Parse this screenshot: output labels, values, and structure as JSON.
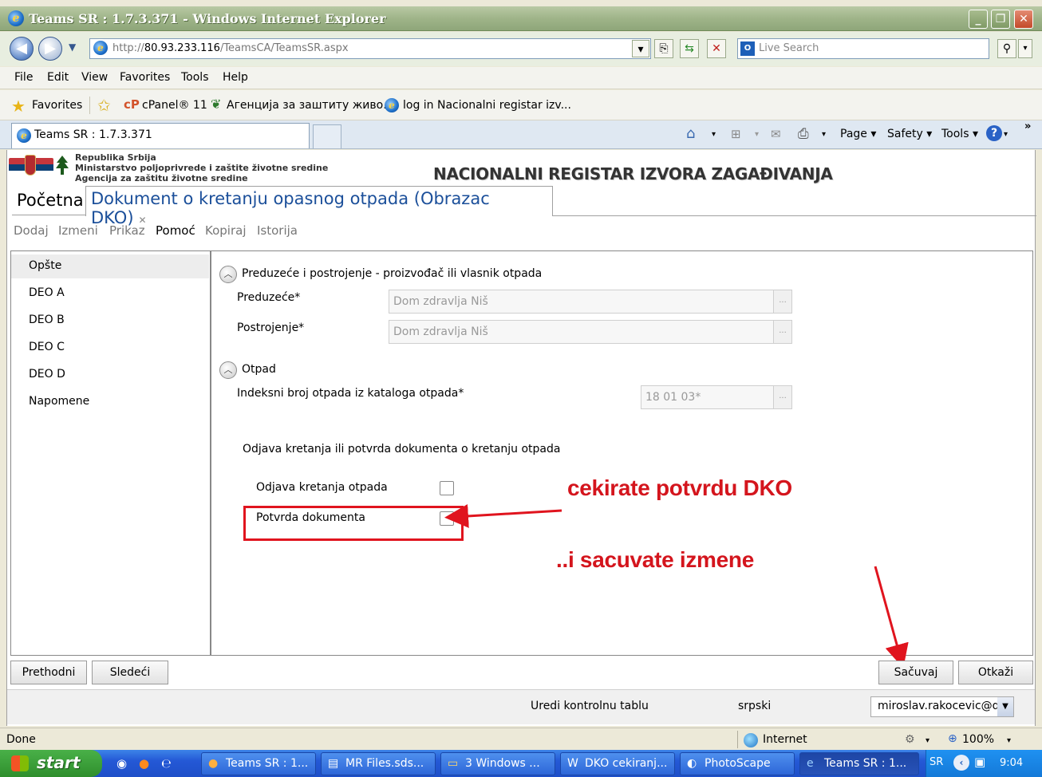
{
  "window": {
    "title": "Teams SR : 1.7.3.371 - Windows Internet Explorer"
  },
  "address": {
    "url_prefix": "http://",
    "url_host": "80.93.233.116",
    "url_path": "/TeamsCA/TeamsSR.aspx",
    "search_placeholder": "Live Search"
  },
  "menu": [
    "File",
    "Edit",
    "View",
    "Favorites",
    "Tools",
    "Help"
  ],
  "favorites": {
    "label": "Favorites",
    "items": [
      "cPanel® 11",
      "Агенција за заштиту живо...",
      "log in Nacionalni registar izv..."
    ]
  },
  "browser_tab": {
    "title": "Teams SR : 1.7.3.371"
  },
  "command_bar": {
    "page": "Page",
    "safety": "Safety",
    "tools": "Tools"
  },
  "header": {
    "agency_lines": [
      "Republika Srbija",
      "Ministarstvo poljoprivrede i zaštite životne sredine",
      "Agencija za zaštitu životne sredine"
    ],
    "banner": "NACIONALNI REGISTAR IZVORA ZAGAĐIVANJA"
  },
  "app_tabs": {
    "home": "Početna",
    "document": "Dokument o kretanju opasnog otpada (Obrazac DKO)"
  },
  "toolbar": [
    "Dodaj",
    "Izmeni",
    "Prikaz",
    "Pomoć",
    "Kopiraj",
    "Istorija"
  ],
  "nav": [
    "Opšte",
    "DEO A",
    "DEO B",
    "DEO C",
    "DEO D",
    "Napomene"
  ],
  "form": {
    "section1": "Preduzeće i postrojenje - proizvođač ili vlasnik otpada",
    "company_label": "Preduzeće*",
    "company_value": "Dom zdravlja Niš",
    "plant_label": "Postrojenje*",
    "plant_value": "Dom zdravlja Niš",
    "section2": "Otpad",
    "waste_index_label": "Indeksni broj otpada iz kataloga otpada*",
    "waste_index_value": "18 01 03*",
    "movement_heading": "Odjava kretanja ili potvrda dokumenta o kretanju otpada",
    "odjava_label": "Odjava kretanja otpada",
    "potvrda_label": "Potvrda dokumenta"
  },
  "annotations": {
    "first": "cekirate potvrdu DKO",
    "second": "..i sacuvate izmene"
  },
  "buttons": {
    "prev": "Prethodni",
    "next": "Sledeći",
    "save": "Sačuvaj",
    "cancel": "Otkaži"
  },
  "footer": {
    "dashboard": "Uredi kontrolnu tablu",
    "language": "srpski",
    "user": "miroslav.rakocevic@dom"
  },
  "status": {
    "left": "Done",
    "zone": "Internet",
    "zoom": "100%"
  },
  "taskbar": {
    "start": "start",
    "tasks": [
      "Teams SR : 1...",
      "MR Files.sds...",
      "3 Windows ...",
      "DKO cekiranj...",
      "PhotoScape",
      "Teams SR : 1..."
    ],
    "lang": "SR",
    "time": "9:04"
  }
}
